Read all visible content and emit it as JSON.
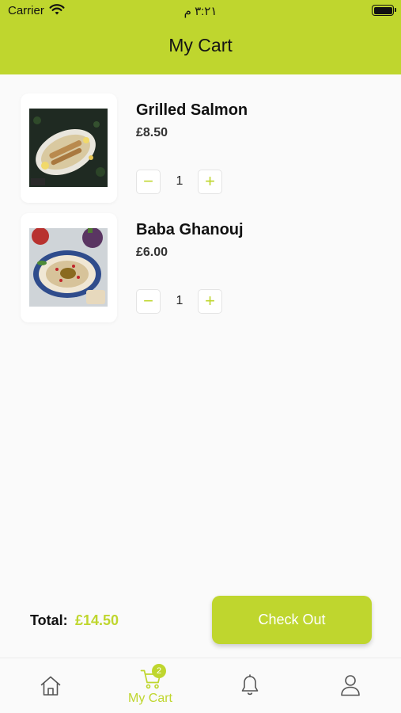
{
  "status_bar": {
    "carrier": "Carrier",
    "time": "٣:٢١ م"
  },
  "header": {
    "title": "My Cart"
  },
  "cart": {
    "items": [
      {
        "name": "Grilled Salmon",
        "price": "£8.50",
        "quantity": "1",
        "image_label": "Salmon",
        "decrease_label": "−",
        "increase_label": "+"
      },
      {
        "name": "Baba Ghanouj",
        "price": "£6.00",
        "quantity": "1",
        "decrease_label": "−",
        "increase_label": "+"
      }
    ]
  },
  "footer": {
    "total_label": "Total:",
    "total_value": "£14.50",
    "checkout_label": "Check Out"
  },
  "bottom_nav": {
    "items": [
      {
        "icon": "home-icon"
      },
      {
        "icon": "cart-icon",
        "label": "My Cart",
        "badge": "2"
      },
      {
        "icon": "bell-icon"
      },
      {
        "icon": "user-icon"
      }
    ]
  },
  "colors": {
    "accent": "#bfd62e",
    "background": "#fafafa"
  }
}
